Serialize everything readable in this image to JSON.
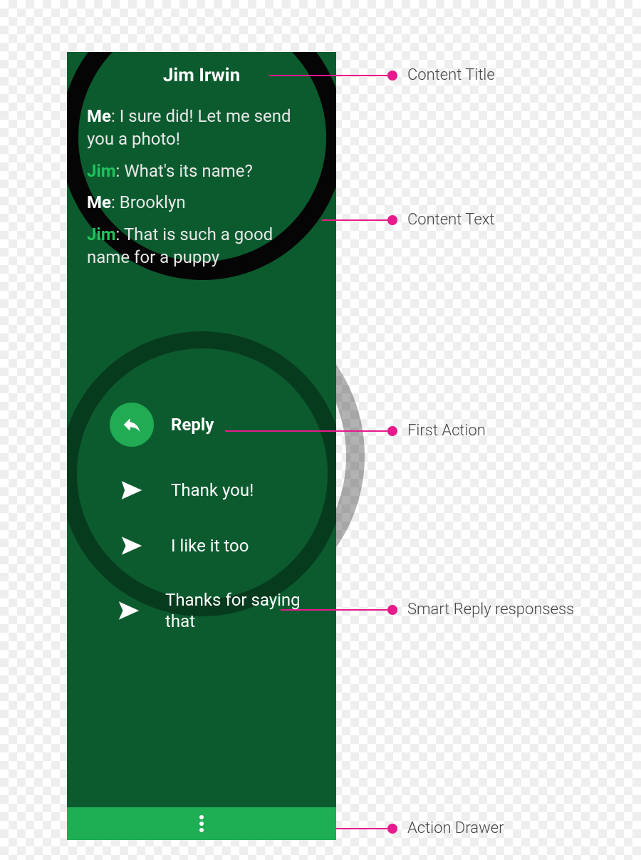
{
  "title": "Jim Irwin",
  "messages": [
    {
      "sender": "Me",
      "class": "me",
      "text": "I sure did! Let me send you a photo!"
    },
    {
      "sender": "Jim",
      "class": "jim",
      "text": "What's its name?"
    },
    {
      "sender": "Me",
      "class": "me",
      "text": "Brooklyn"
    },
    {
      "sender": "Jim",
      "class": "jim",
      "text": "That is such a good name for a puppy"
    }
  ],
  "reply_label": "Reply",
  "smart_replies": [
    "Thank you!",
    "I like it too",
    "Thanks for saying that"
  ],
  "callouts": {
    "content_title": "Content Title",
    "content_text": "Content Text",
    "first_action": "First Action",
    "smart_reply": "Smart Reply responsess",
    "action_drawer": "Action Drawer"
  },
  "colors": {
    "panel": "#0c5b2f",
    "accent": "#21ab53",
    "drawer": "#1eae54",
    "callout": "#e71a8b",
    "jim_name": "#21c25d"
  }
}
